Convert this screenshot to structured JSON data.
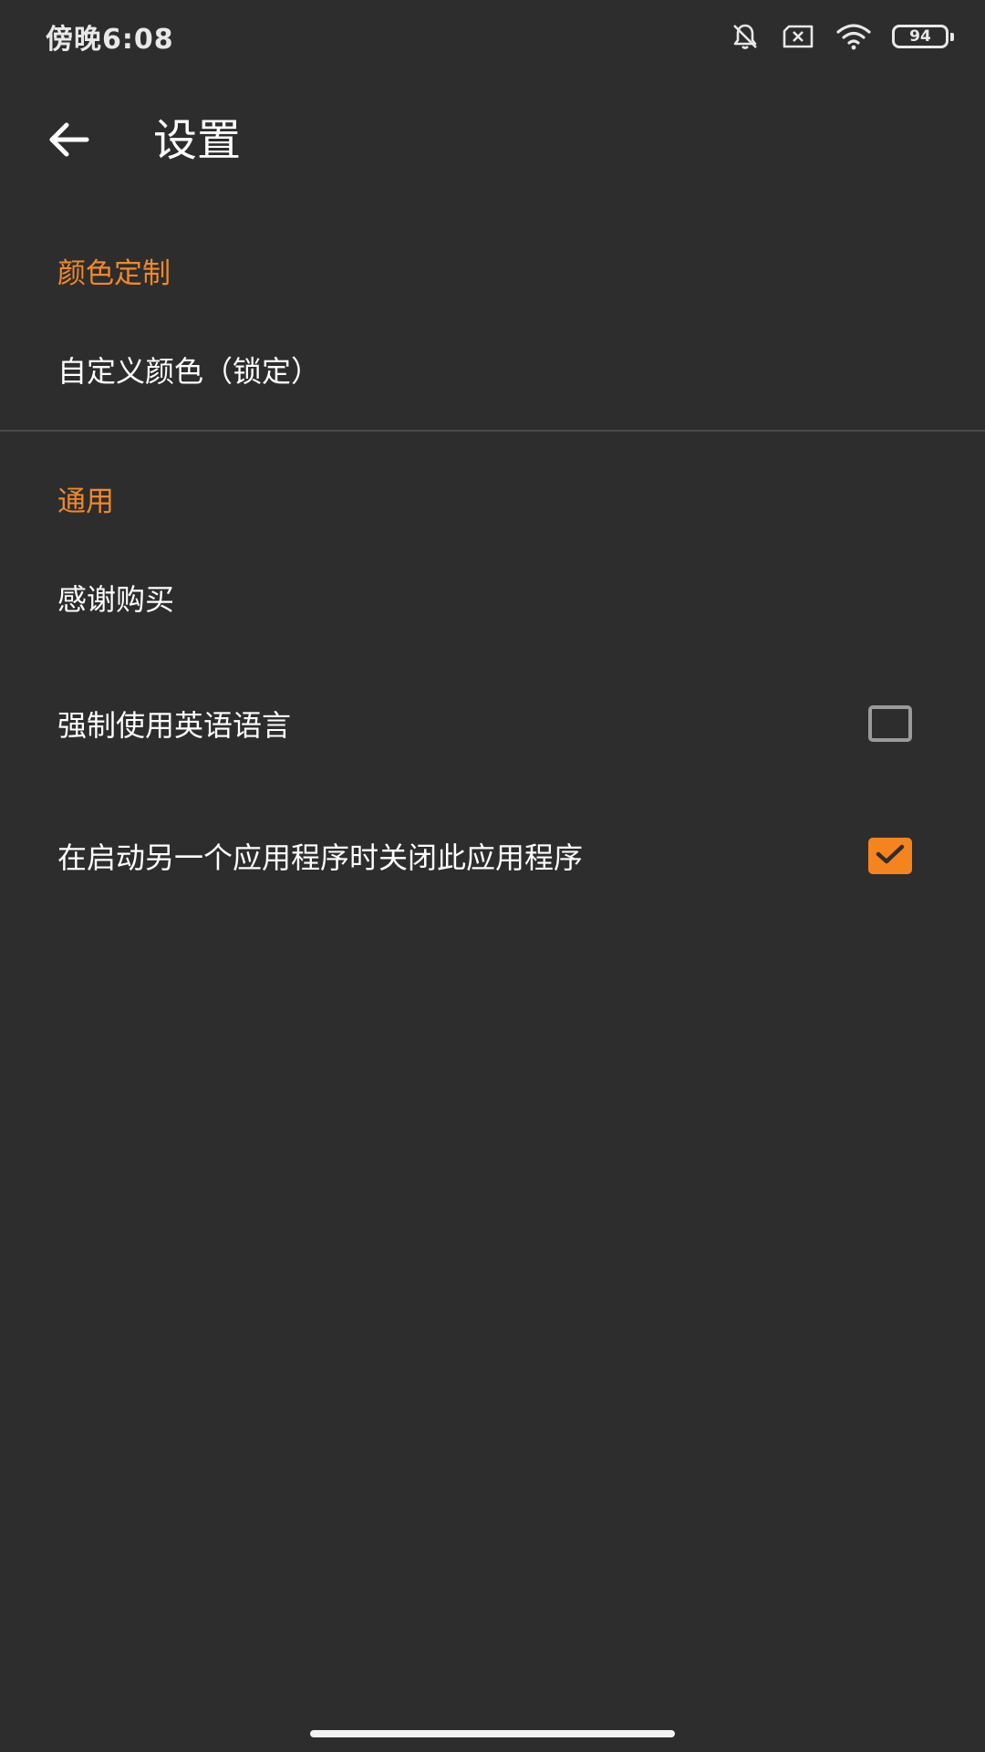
{
  "status_bar": {
    "time": "傍晚6:08",
    "battery_level": "94",
    "icons": [
      "bell-off-icon",
      "sim-off-icon",
      "wifi-icon",
      "battery-icon"
    ]
  },
  "toolbar": {
    "back_icon": "arrow-left-icon",
    "title": "设置"
  },
  "sections": [
    {
      "header": "颜色定制",
      "items": [
        {
          "label": "自定义颜色（锁定）"
        }
      ]
    },
    {
      "header": "通用",
      "items": [
        {
          "label": "感谢购买"
        },
        {
          "label": "强制使用英语语言",
          "checked": false
        },
        {
          "label": "在启动另一个应用程序时关闭此应用程序",
          "checked": true
        }
      ]
    }
  ],
  "colors": {
    "background": "#2d2d2d",
    "accent": "#f5841f",
    "section_header": "#f0892a",
    "text": "#ffffff"
  }
}
